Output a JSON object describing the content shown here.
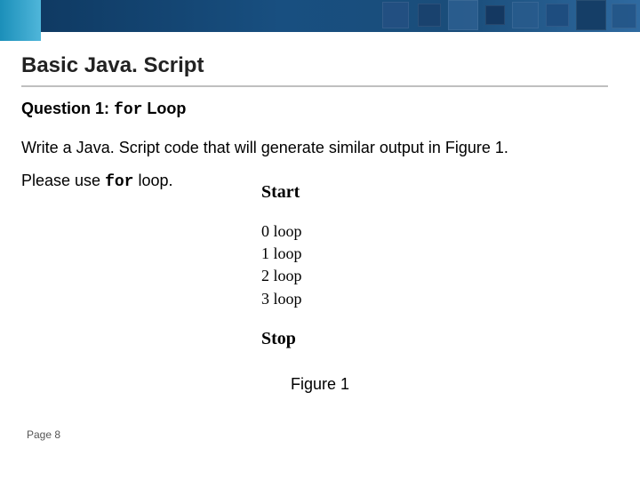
{
  "heading": "Basic Java. Script",
  "question_prefix": "Question 1: ",
  "question_code": "for",
  "question_suffix": " Loop",
  "body1": "Write a Java. Script code that will generate similar output in Figure 1.",
  "body2_prefix": "Please use ",
  "body2_code": "for",
  "body2_suffix": " loop.",
  "figure": {
    "start": "Start",
    "lines": [
      "0 loop",
      "1 loop",
      "2 loop",
      "3 loop"
    ],
    "stop": "Stop",
    "caption": "Figure 1"
  },
  "page": "Page 8"
}
